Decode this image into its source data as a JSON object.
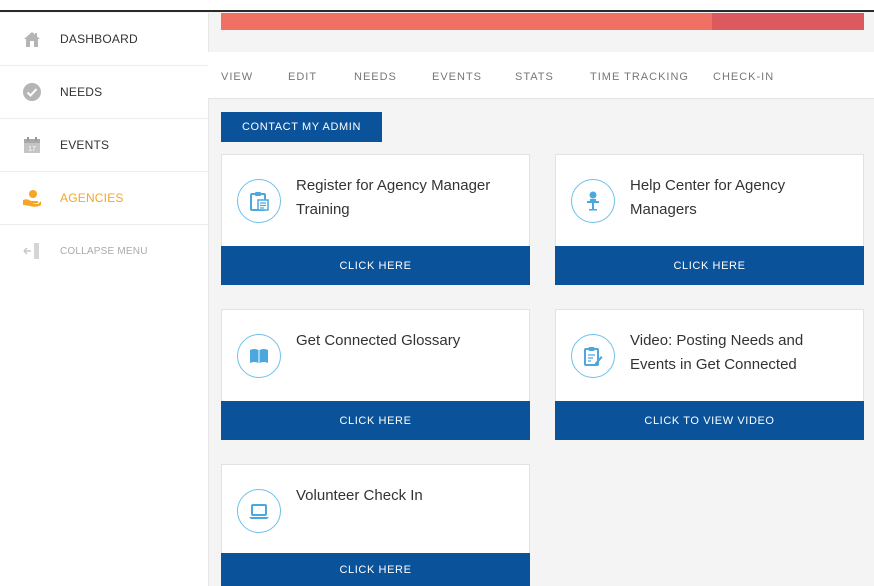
{
  "sidebar": {
    "items": [
      {
        "label": "DASHBOARD",
        "icon": "home-icon"
      },
      {
        "label": "NEEDS",
        "icon": "check-circle-icon"
      },
      {
        "label": "EVENTS",
        "icon": "calendar-icon"
      },
      {
        "label": "AGENCIES",
        "icon": "agency-hand-icon",
        "active": true
      },
      {
        "label": "COLLAPSE MENU",
        "icon": "collapse-arrow-icon"
      }
    ]
  },
  "tabs": [
    "VIEW",
    "EDIT",
    "NEEDS",
    "EVENTS",
    "STATS",
    "TIME TRACKING",
    "CHECK-IN"
  ],
  "contact_button": "CONTACT MY ADMIN",
  "cards": [
    {
      "title": "Register for Agency Manager Training",
      "cta": "CLICK HERE",
      "icon": "clipboard-icon"
    },
    {
      "title": "Help Center for Agency Managers",
      "cta": "CLICK HERE",
      "icon": "person-desk-icon"
    },
    {
      "title": "Get Connected Glossary",
      "cta": "CLICK HERE",
      "icon": "book-icon"
    },
    {
      "title": "Video: Posting Needs and Events in Get Connected",
      "cta": "CLICK TO VIEW VIDEO",
      "icon": "clipboard-edit-icon"
    },
    {
      "title": "Volunteer Check In",
      "cta": "CLICK HERE",
      "icon": "laptop-icon"
    }
  ],
  "colors": {
    "primary": "#0a5299",
    "accent_active": "#f5a623",
    "banner": "#f07164",
    "banner_end": "#dc5a5e",
    "icon_outline": "#6ec1ea"
  }
}
